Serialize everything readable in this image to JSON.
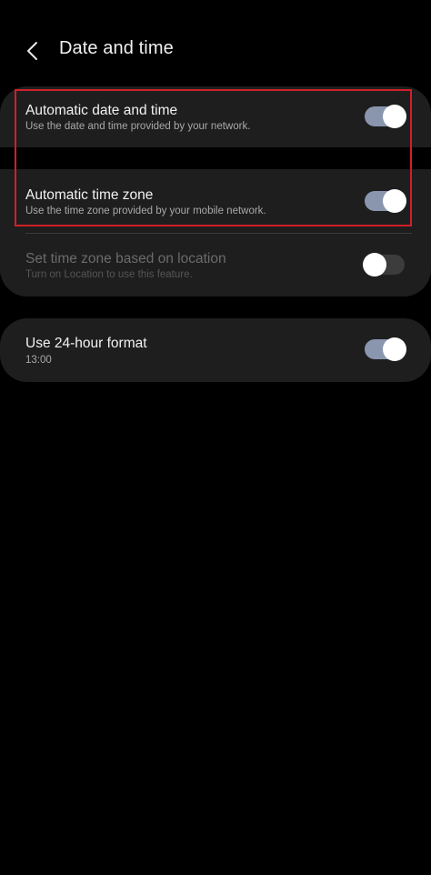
{
  "header": {
    "title": "Date and time",
    "back_icon": "chevron-left-icon"
  },
  "settings": {
    "auto_date_time": {
      "title": "Automatic date and time",
      "subtitle": "Use the date and time provided by your network.",
      "enabled": true
    },
    "auto_time_zone": {
      "title": "Automatic time zone",
      "subtitle": "Use the time zone provided by your mobile network.",
      "enabled": true
    },
    "location_time_zone": {
      "title": "Set time zone based on location",
      "subtitle": "Turn on Location to use this feature.",
      "enabled": false,
      "disabled": true
    },
    "hour_format_24": {
      "title": "Use 24-hour format",
      "subtitle": "13:00",
      "enabled": true
    }
  },
  "colors": {
    "background": "#000000",
    "card": "#1e1e1e",
    "toggle_on": "#8a96ae",
    "toggle_off": "#3c3c3c",
    "highlight": "#d0202a"
  }
}
